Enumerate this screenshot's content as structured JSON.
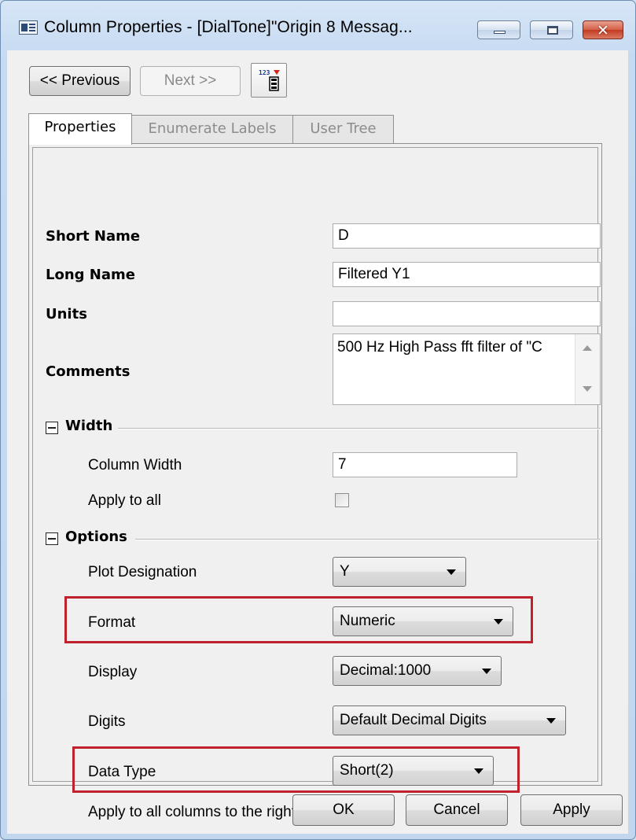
{
  "window": {
    "title": "Column Properties - [DialTone]\"Origin 8 Messag...",
    "close_glyph": "✕"
  },
  "toolbar": {
    "previous_label": "<< Previous",
    "next_label": "Next >>",
    "header_icon": "column-label-rows-icon"
  },
  "tabs": [
    {
      "label": "Properties",
      "active": true
    },
    {
      "label": "Enumerate Labels",
      "active": false
    },
    {
      "label": "User Tree",
      "active": false
    }
  ],
  "properties": {
    "short_name_label": "Short Name",
    "short_name_value": "D",
    "long_name_label": "Long Name",
    "long_name_value": "Filtered Y1",
    "units_label": "Units",
    "units_value": "",
    "comments_label": "Comments",
    "comments_value": "500 Hz High Pass fft filter of \"C"
  },
  "width_section": {
    "title": "Width",
    "column_width_label": "Column Width",
    "column_width_value": "7",
    "apply_to_all_label": "Apply to all",
    "apply_to_all_checked": false
  },
  "options_section": {
    "title": "Options",
    "plot_designation_label": "Plot Designation",
    "plot_designation_value": "Y",
    "format_label": "Format",
    "format_value": "Numeric",
    "display_label": "Display",
    "display_value": "Decimal:1000",
    "digits_label": "Digits",
    "digits_value": "Default Decimal Digits",
    "data_type_label": "Data Type",
    "data_type_value": "Short(2)",
    "apply_right_label": "Apply to all columns to the right",
    "apply_right_checked": false
  },
  "footer": {
    "ok_label": "OK",
    "cancel_label": "Cancel",
    "apply_label": "Apply"
  },
  "colors": {
    "highlight": "#c0222c",
    "titlebar": "#c6daf1",
    "close_button": "#c23b22"
  }
}
